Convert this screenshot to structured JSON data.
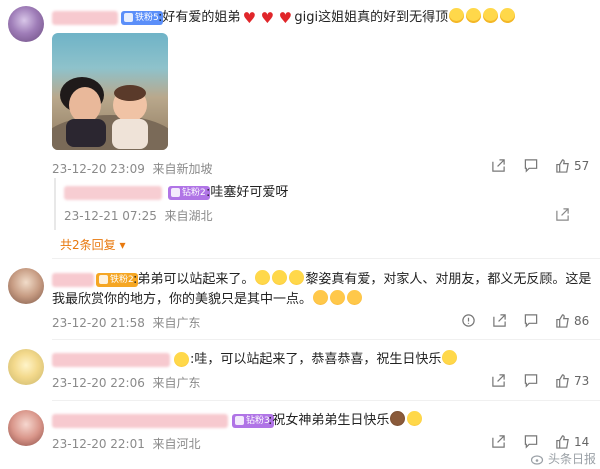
{
  "comments": [
    {
      "username": "",
      "badge": "铁粉5",
      "text_a": ":好有爱的姐弟",
      "text_b": "gigi这姐姐真的好到无得顶",
      "time": "23-12-20 23:09",
      "location": "来自新加坡",
      "likes": "57",
      "reply": {
        "username": "",
        "badge": "钻粉2",
        "text": ":哇塞好可爱呀",
        "time": "23-12-21 07:25",
        "location": "来自湖北"
      },
      "more_replies": "共2条回复"
    },
    {
      "username": "",
      "badge": "铁粉2",
      "text_a": ":弟弟可以站起来了。",
      "text_b": "黎姿真有爱，对家人、对朋友，都义无反顾。这是",
      "text_c": "我最欣赏你的地方，你的美貌只是其中一点。",
      "time": "23-12-20 21:58",
      "location": "来自广东",
      "likes": "86"
    },
    {
      "username": "",
      "text": ":哇，可以站起来了，恭喜恭喜，祝生日快乐",
      "time": "23-12-20 22:06",
      "location": "来自广东",
      "likes": "73"
    },
    {
      "username": "",
      "badge": "钻粉3",
      "text": ":祝女神弟弟生日快乐",
      "time": "23-12-20 22:01",
      "location": "来自河北",
      "likes": "14"
    }
  ],
  "watermark": "头条日报",
  "colors": {
    "badge_iron": "#5b8ff9",
    "badge_diamond": "#b074e6",
    "badge_orange": "#f5a623",
    "link": "#e8790e"
  },
  "icons": [
    "share-icon",
    "comment-icon",
    "like-icon",
    "reply-share-icon"
  ]
}
